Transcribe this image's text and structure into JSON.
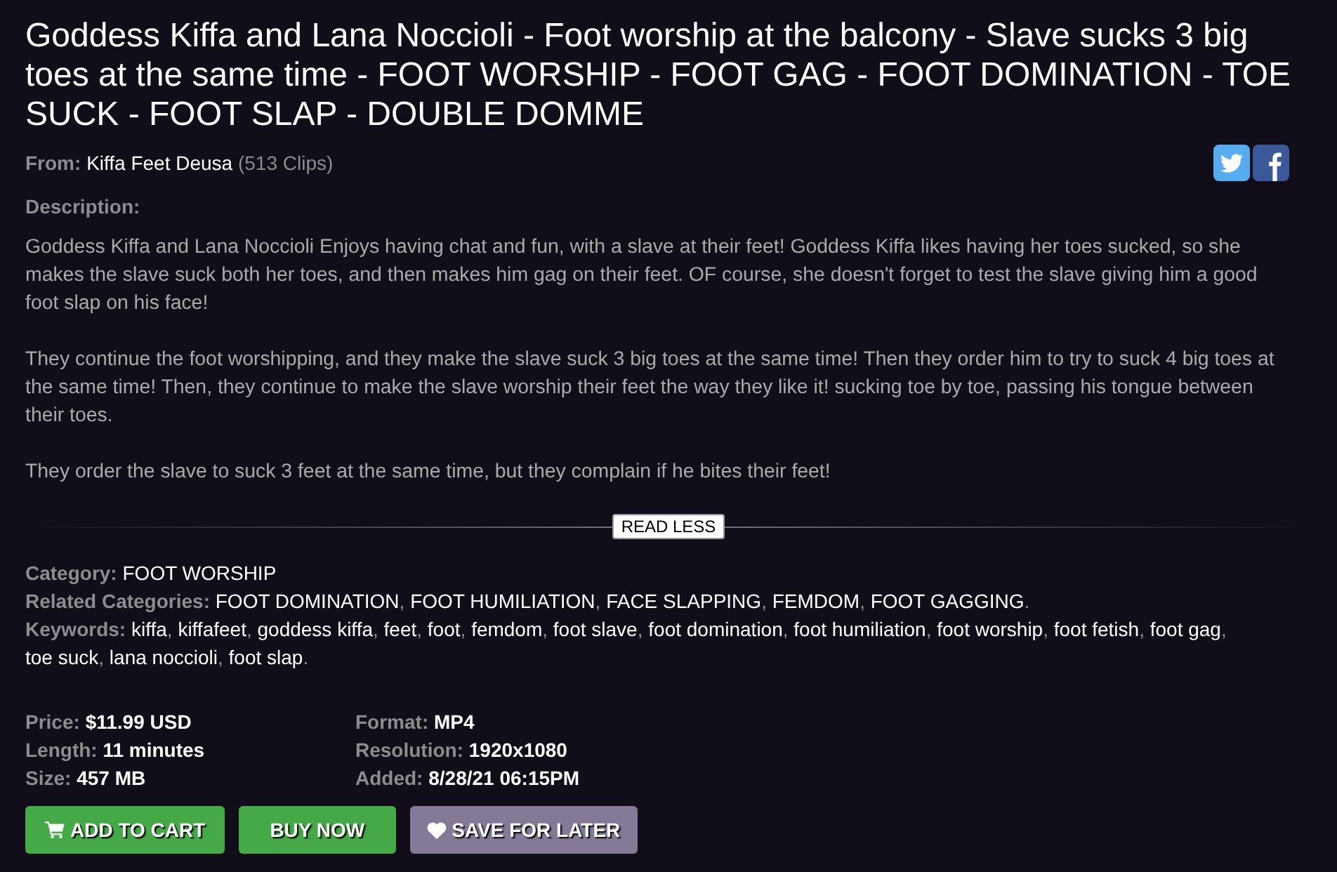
{
  "title": "Goddess Kiffa and Lana Noccioli - Foot worship at the balcony - Slave sucks 3 big toes at the same time - FOOT WORSHIP - FOOT GAG - FOOT DOMINATION - TOE SUCK - FOOT SLAP - DOUBLE DOMME",
  "from": {
    "label": "From:",
    "seller": "Kiffa Feet Deusa",
    "clip_count": "(513 Clips)"
  },
  "description": {
    "label": "Description:",
    "paragraphs": [
      "Goddess Kiffa and Lana Noccioli Enjoys having chat and fun, with a slave at their feet! Goddess Kiffa likes having her toes sucked, so she makes the slave suck both her toes, and then makes him gag on their feet. OF course, she doesn't forget to test the slave giving him a good foot slap on his face!",
      "They continue the foot worshipping, and they make the slave suck 3 big toes at the same time! Then they order him to try to suck 4 big toes at the same time! Then, they continue to make the slave worship their feet the way they like it! sucking toe by toe, passing his tongue between their toes.",
      "They order the slave to suck 3 feet at the same time, but they complain if he bites their feet!"
    ]
  },
  "read_less": "READ LESS",
  "tag_lines": [
    {
      "label": "Category:",
      "values": [
        "FOOT WORSHIP"
      ]
    },
    {
      "label": "Related Categories:",
      "values": [
        "FOOT DOMINATION",
        "FOOT HUMILIATION",
        "FACE SLAPPING",
        "FEMDOM",
        "FOOT GAGGING"
      ],
      "separator": ", ",
      "end": "."
    },
    {
      "label": "Keywords:",
      "values": [
        "kiffa",
        "kiffafeet",
        "goddess kiffa",
        "feet",
        "foot",
        "femdom",
        "foot slave",
        "foot domination",
        "foot humiliation",
        "foot worship",
        "foot fetish",
        "foot gag",
        "toe suck",
        "lana noccioli",
        "foot slap"
      ],
      "separator": ", ",
      "end": "."
    }
  ],
  "details": [
    [
      {
        "label": "Price:",
        "value": "$11.99 USD"
      },
      {
        "label": "Length:",
        "value": "11 minutes"
      },
      {
        "label": "Size:",
        "value": "457 MB"
      }
    ],
    [
      {
        "label": "Format:",
        "value": "MP4"
      },
      {
        "label": "Resolution:",
        "value": "1920x1080"
      },
      {
        "label": "Added:",
        "value": "8/28/21 06:15PM"
      }
    ]
  ],
  "buttons": [
    {
      "label": "ADD TO CART",
      "kind": "cart"
    },
    {
      "label": "BUY NOW",
      "kind": "buy"
    },
    {
      "label": "SAVE FOR LATER",
      "kind": "save"
    }
  ]
}
